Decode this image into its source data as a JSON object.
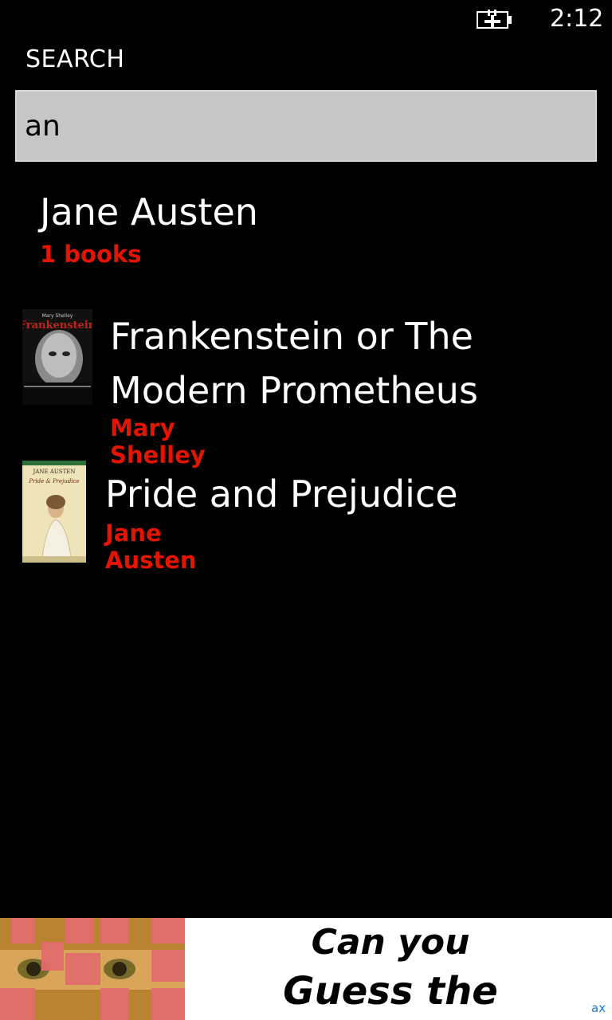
{
  "status": {
    "time": "2:12",
    "battery_icon": "battery-charging-icon"
  },
  "page": {
    "title": "SEARCH"
  },
  "search": {
    "value": "an"
  },
  "results": {
    "author": {
      "name": "Jane Austen",
      "count": "1 books"
    },
    "books": [
      {
        "title": "Frankenstein or The Modern Prometheus",
        "author": "Mary Shelley",
        "cover": {
          "text_top": "Mary Shelley",
          "text_main": "Frankenstein"
        }
      },
      {
        "title": "Pride and Prejudice",
        "author": "Jane Austen",
        "cover": {
          "text_top": "JANE AUSTEN",
          "text_main": "Pride & Prejudice"
        }
      }
    ]
  },
  "ad": {
    "line1": "Can you",
    "line2": "Guess the Picture?",
    "mark": "ax"
  },
  "colors": {
    "accent": "#e51400",
    "background": "#000000",
    "search_bg": "#c6c6c6"
  }
}
